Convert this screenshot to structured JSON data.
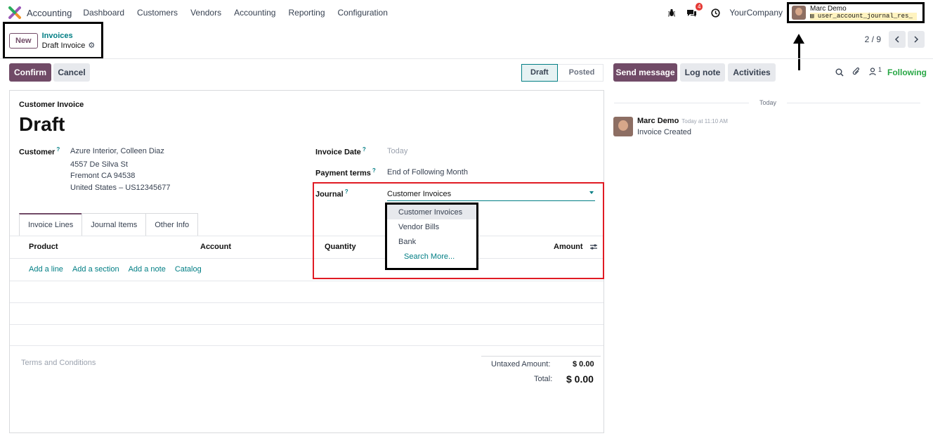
{
  "navbar": {
    "app_title": "Accounting",
    "menu": [
      "Dashboard",
      "Customers",
      "Vendors",
      "Accounting",
      "Reporting",
      "Configuration"
    ],
    "messages_badge": "4",
    "company": "YourCompany",
    "user_name": "Marc Demo",
    "user_db": "user_account_journal_res_"
  },
  "control_panel": {
    "new_label": "New",
    "breadcrumb_parent": "Invoices",
    "breadcrumb_current": "Draft Invoice",
    "pager_value": "2 / 9"
  },
  "actions": {
    "confirm": "Confirm",
    "cancel": "Cancel",
    "status_draft": "Draft",
    "status_posted": "Posted",
    "send_message": "Send message",
    "log_note": "Log note",
    "activities": "Activities",
    "followers_count": "1",
    "following": "Following"
  },
  "form": {
    "type_label": "Customer Invoice",
    "state_title": "Draft",
    "customer_label": "Customer",
    "customer_name": "Azure Interior, Colleen Diaz",
    "customer_street": "4557 De Silva St",
    "customer_city": "Fremont CA 94538",
    "customer_country": "United States – US12345677",
    "invoice_date_label": "Invoice Date",
    "invoice_date_value": "Today",
    "payment_terms_label": "Payment terms",
    "payment_terms_value": "End of Following Month",
    "journal_label": "Journal",
    "journal_value": "Customer Invoices",
    "journal_options": [
      "Customer Invoices",
      "Vendor Bills",
      "Bank"
    ],
    "journal_search_more": "Search More...",
    "tabs": [
      "Invoice Lines",
      "Journal Items",
      "Other Info"
    ],
    "columns": {
      "product": "Product",
      "account": "Account",
      "quantity": "Quantity",
      "amount": "Amount"
    },
    "line_actions": [
      "Add a line",
      "Add a section",
      "Add a note",
      "Catalog"
    ],
    "terms_placeholder": "Terms and Conditions",
    "untaxed_label": "Untaxed Amount:",
    "untaxed_value": "$ 0.00",
    "total_label": "Total:",
    "total_value": "$ 0.00"
  },
  "chatter": {
    "day_separator": "Today",
    "author": "Marc Demo",
    "timestamp": "Today at 11:10 AM",
    "message": "Invoice Created"
  },
  "colors": {
    "primary": "#714b67",
    "link": "#017e84",
    "highlight_box": "#e01b24",
    "following": "#28a745"
  }
}
